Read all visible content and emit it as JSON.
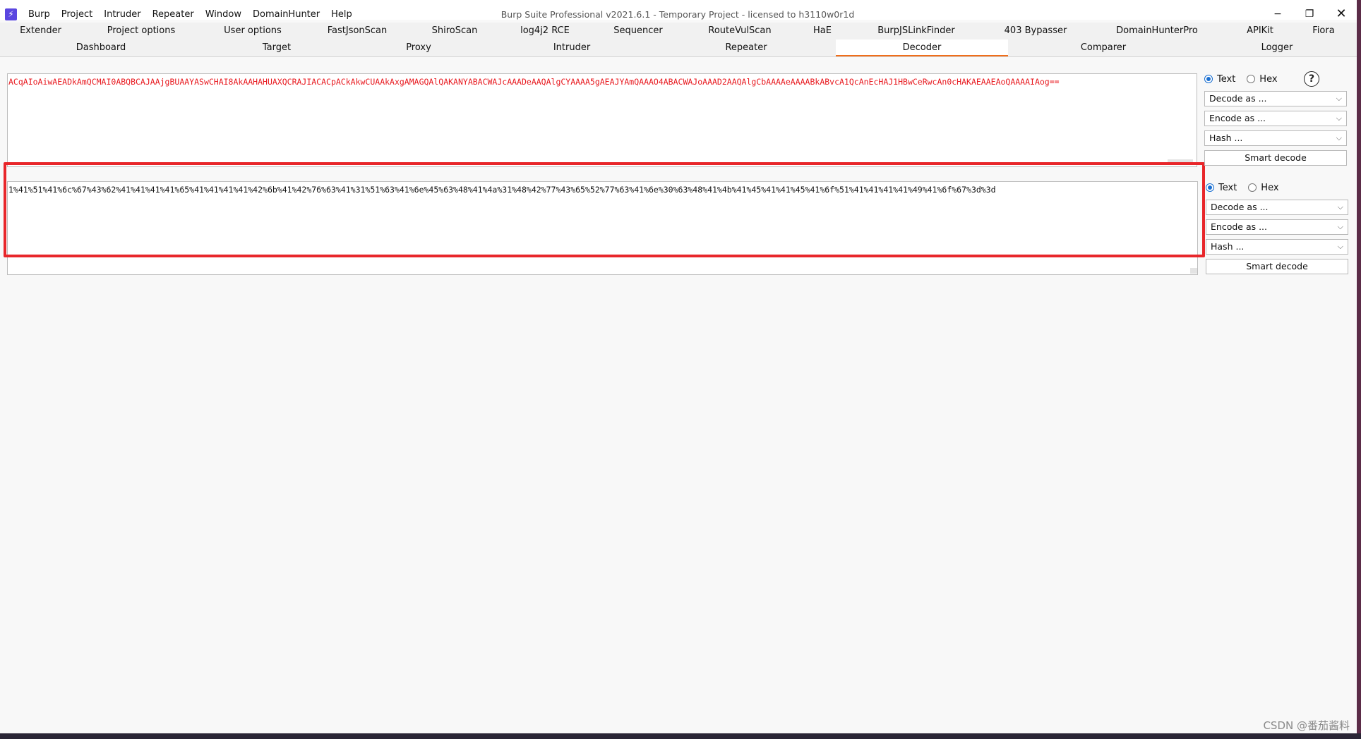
{
  "app": {
    "logo_glyph": "⚡",
    "window_title": "Burp Suite Professional v2021.6.1 - Temporary Project - licensed to h3110w0r1d",
    "menu": [
      "Burp",
      "Project",
      "Intruder",
      "Repeater",
      "Window",
      "DomainHunter",
      "Help"
    ],
    "window_controls": {
      "minimize": "−",
      "maximize": "❐",
      "close": "✕"
    }
  },
  "tabs": {
    "row1": [
      "Extender",
      "Project options",
      "User options",
      "FastJsonScan",
      "ShiroScan",
      "log4j2 RCE",
      "Sequencer",
      "RouteVulScan",
      "HaE",
      "BurpJSLinkFinder",
      "403 Bypasser",
      "DomainHunterPro",
      "APIKit",
      "Fiora"
    ],
    "row2": [
      "Dashboard",
      "Target",
      "Proxy",
      "Intruder",
      "Repeater",
      "Decoder",
      "Comparer",
      "Logger"
    ],
    "active": "Decoder"
  },
  "decoder": {
    "input_text": "ACqAIoAiwAEADkAmQCMAI0ABQBCAJAAjgBUAAYASwCHAI8AkAAHAHUAXQCRAJIACACpACkAkwCUAAkAxgAMAGQAlQAKANYABACWAJcAAADeAAQAlgCYAAAA5gAEAJYAmQAAAO4ABACWAJoAAAD2AAQAlgCbAAAAeAAAABkABvcA1QcAnEcHAJ1HBwCeRwcAn0cHAKAEAAEAoQAAAAIAog==",
    "output_text": "1%41%51%41%6c%67%43%62%41%41%41%41%65%41%41%41%41%42%6b%41%42%76%63%41%31%51%63%41%6e%45%63%48%41%4a%31%48%42%77%43%65%52%77%63%41%6e%30%63%48%41%4b%41%45%41%41%45%41%6f%51%41%41%41%41%49%41%6f%67%3d%3d",
    "panel1": {
      "radio_text": "Text",
      "radio_hex": "Hex",
      "selected": "Text",
      "help_glyph": "?",
      "decode_label": "Decode as ...",
      "encode_label": "Encode as ...",
      "hash_label": "Hash ...",
      "smart_decode_label": "Smart decode"
    },
    "panel2": {
      "radio_text": "Text",
      "radio_hex": "Hex",
      "selected": "Text",
      "decode_label": "Decode as ...",
      "encode_label": "Encode as ...",
      "hash_label": "Hash ...",
      "smart_decode_label": "Smart decode"
    }
  },
  "watermark": "CSDN @番茄酱料",
  "colors": {
    "accent": "#f06e1a",
    "input_text": "#e8191f",
    "highlight": "#e8262a"
  }
}
